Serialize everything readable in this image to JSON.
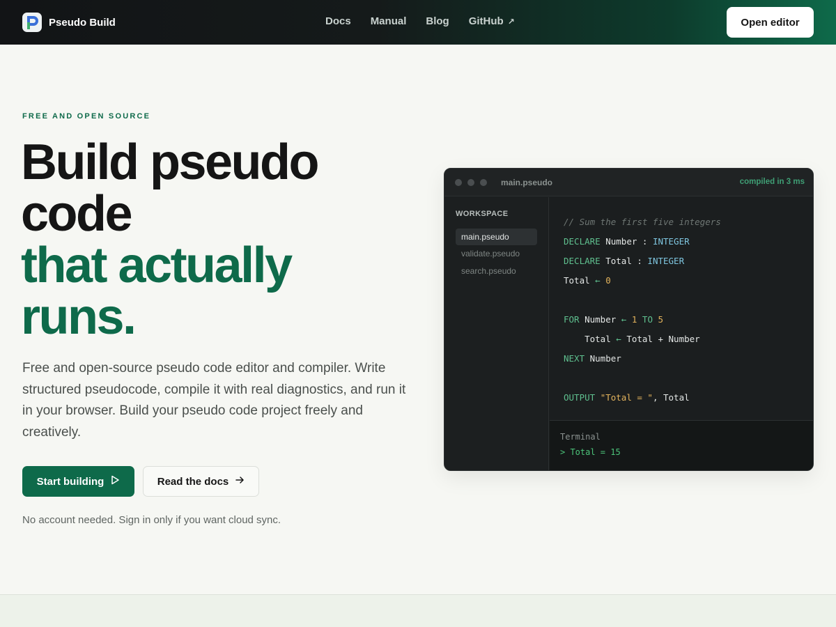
{
  "header": {
    "brand": "Pseudo Build",
    "logo_icon": "pseudo-build-logo",
    "nav": [
      {
        "label": "Docs"
      },
      {
        "label": "Manual"
      },
      {
        "label": "Blog"
      },
      {
        "label": "GitHub",
        "icon": "external-arrow-icon",
        "glyph": "↗"
      }
    ],
    "cta": "Open editor"
  },
  "hero": {
    "eyebrow": "FREE AND OPEN SOURCE",
    "headline_dark": "Build pseudo code",
    "headline_green": "that actually runs.",
    "lede": "Free and open-source pseudo code editor and compiler. Write structured pseudocode, compile it with real diagnostics, and run it in your browser. Build your pseudo code project freely and creatively.",
    "primary_button": "Start building",
    "primary_icon": "play-icon",
    "secondary_button": "Read the docs",
    "secondary_icon": "arrow-right-icon",
    "note": "No account needed. Sign in only if you want cloud sync."
  },
  "editor": {
    "filename": "main.pseudo",
    "status": "compiled in 3 ms",
    "workspace_label": "WORKSPACE",
    "files": [
      {
        "name": "main.pseudo",
        "active": true
      },
      {
        "name": "validate.pseudo",
        "active": false
      },
      {
        "name": "search.pseudo",
        "active": false
      }
    ],
    "code": [
      [
        {
          "t": "// Sum the first five integers",
          "c": "comment"
        }
      ],
      [
        {
          "t": "DECLARE",
          "c": "kw"
        },
        {
          "t": " Number : ",
          "c": "plain"
        },
        {
          "t": "INTEGER",
          "c": "type"
        }
      ],
      [
        {
          "t": "DECLARE",
          "c": "kw"
        },
        {
          "t": " Total : ",
          "c": "plain"
        },
        {
          "t": "INTEGER",
          "c": "type"
        }
      ],
      [
        {
          "t": "Total ",
          "c": "plain"
        },
        {
          "t": "←",
          "c": "op"
        },
        {
          "t": " ",
          "c": "plain"
        },
        {
          "t": "0",
          "c": "num"
        }
      ],
      [],
      [
        {
          "t": "FOR",
          "c": "kw"
        },
        {
          "t": " Number ",
          "c": "plain"
        },
        {
          "t": "←",
          "c": "op"
        },
        {
          "t": " ",
          "c": "plain"
        },
        {
          "t": "1",
          "c": "num"
        },
        {
          "t": " ",
          "c": "plain"
        },
        {
          "t": "TO",
          "c": "kw"
        },
        {
          "t": " ",
          "c": "plain"
        },
        {
          "t": "5",
          "c": "num"
        }
      ],
      [
        {
          "t": "    Total ",
          "c": "plain"
        },
        {
          "t": "←",
          "c": "op"
        },
        {
          "t": " Total + Number",
          "c": "plain"
        }
      ],
      [
        {
          "t": "NEXT",
          "c": "kw"
        },
        {
          "t": " Number",
          "c": "plain"
        }
      ],
      [],
      [
        {
          "t": "OUTPUT",
          "c": "kw"
        },
        {
          "t": " ",
          "c": "plain"
        },
        {
          "t": "\"Total = \"",
          "c": "str"
        },
        {
          "t": ", Total",
          "c": "plain"
        }
      ]
    ],
    "terminal_title": "Terminal",
    "terminal_output": "> Total = 15"
  },
  "colors": {
    "brand_green": "#0e6a4a",
    "header_dark": "#121416",
    "page_bg": "#f6f7f3"
  }
}
